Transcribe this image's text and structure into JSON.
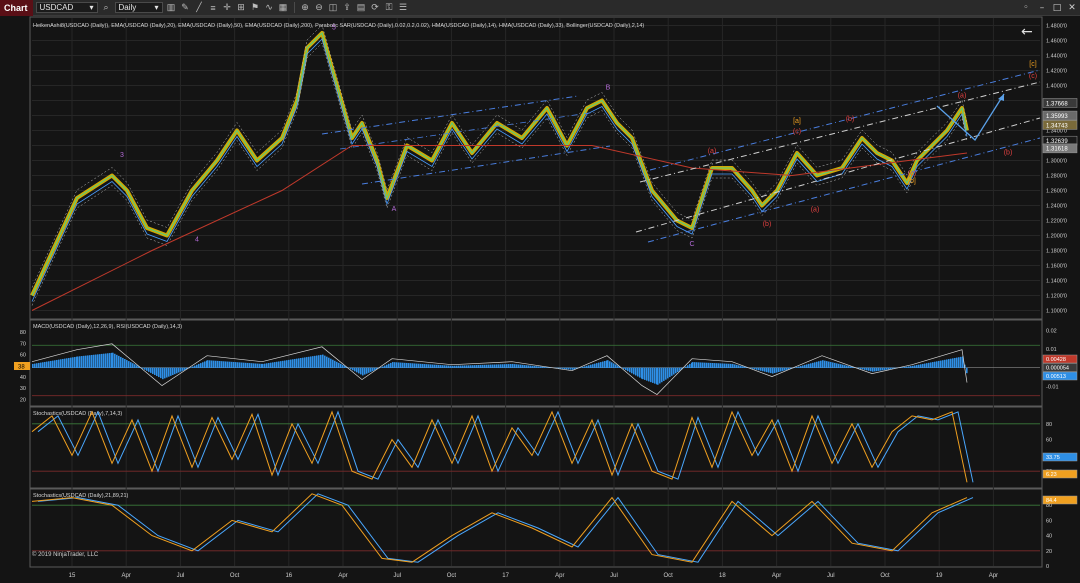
{
  "app": {
    "title": "Chart"
  },
  "toolbar": {
    "instrument": "USDCAD",
    "timeframe": "Daily",
    "icons": [
      "search-icon",
      "bar-chart-icon",
      "drawing-tool-icon",
      "line-tool-icon",
      "text-tool-icon",
      "crosshair-icon",
      "properties-icon",
      "strategy-icon",
      "indicator-icon",
      "template-icon",
      "zoom-in-icon",
      "zoom-out-icon",
      "screenshot-icon",
      "share-icon",
      "calendar-icon",
      "sync-icon",
      "lock-icon",
      "list-icon"
    ],
    "window_controls": [
      "pin-icon",
      "minimize-icon",
      "maximize-icon",
      "close-icon"
    ]
  },
  "copyright": "© 2019 NinjaTrader, LLC",
  "colors": {
    "background": "#141414",
    "heiken_up": "#f2c200",
    "ema_fast": "#4a9eff",
    "ema_slow": "#c0392b",
    "channel": "#4a7fe0",
    "wave_label": "#b36bd6",
    "macd_hist": "#2e8fe6",
    "stoch_k": "#f0a020",
    "stoch_d": "#4aa8ff",
    "grid": "#2e2e2e"
  },
  "chart_data": [
    {
      "type": "line",
      "title": "HeikenAshi8(USDCAD (Daily)), EMA(USDCAD (Daily),20), EMA(USDCAD (Daily),50), EMA(USDCAD (Daily),200), Parabolic SAR(USDCAD (Daily),0.02,0.2,0.02), HMA(USDCAD (Daily),14), HMA(USDCAD (Daily),33), Bollinger(USDCAD (Daily),2,14)",
      "x_ticks": [
        "15",
        "Apr",
        "Jul",
        "Oct",
        "16",
        "Apr",
        "Jul",
        "Oct",
        "17",
        "Apr",
        "Jul",
        "Oct",
        "18",
        "Apr",
        "Jul",
        "Oct",
        "19",
        "Apr"
      ],
      "ylim": [
        1.09,
        1.49
      ],
      "y_ticks": [
        "1.1000'0",
        "1.1200'0",
        "1.1400'0",
        "1.1600'0",
        "1.1800'0",
        "1.2000'0",
        "1.2200'0",
        "1.2400'0",
        "1.2600'0",
        "1.2800'0",
        "1.3000'0",
        "1.3200'0",
        "1.3400'0",
        "1.3600'0",
        "1.3800'0",
        "1.4000'0",
        "1.4200'0",
        "1.4400'0",
        "1.4600'0",
        "1.4800'0"
      ],
      "price_tags": [
        {
          "text": "1.37668",
          "color": "#3a3a3a"
        },
        {
          "text": "1.35993",
          "color": "#6a6a6a"
        },
        {
          "text": "1.34743",
          "color": "#7a6a3a"
        },
        {
          "text": "1.32639",
          "color": "#1a1a1a"
        },
        {
          "text": "1.31618",
          "color": "#7a7a7a"
        }
      ],
      "series": [
        {
          "x": [
            0,
            45,
            80,
            95,
            115,
            135,
            160,
            185,
            205,
            225,
            250,
            265,
            275,
            290,
            305,
            320,
            330,
            345,
            355,
            375,
            400,
            420,
            440,
            465,
            490,
            515,
            535,
            555,
            570,
            585,
            600,
            620,
            645,
            660,
            680,
            700,
            720,
            730,
            745,
            765,
            785,
            810,
            830,
            845,
            860,
            875,
            885,
            900,
            915,
            930,
            935
          ],
          "values": [
            1.12,
            1.25,
            1.28,
            1.26,
            1.21,
            1.2,
            1.26,
            1.3,
            1.34,
            1.3,
            1.33,
            1.38,
            1.45,
            1.47,
            1.4,
            1.33,
            1.35,
            1.3,
            1.25,
            1.32,
            1.3,
            1.35,
            1.31,
            1.35,
            1.33,
            1.37,
            1.32,
            1.37,
            1.38,
            1.35,
            1.33,
            1.26,
            1.22,
            1.21,
            1.29,
            1.29,
            1.26,
            1.24,
            1.26,
            1.31,
            1.28,
            1.29,
            1.33,
            1.31,
            1.3,
            1.27,
            1.3,
            1.32,
            1.34,
            1.37,
            1.34
          ]
        }
      ],
      "annotations": [
        {
          "text": "3",
          "x": 90,
          "y": 1.305,
          "color": "#b36bd6"
        },
        {
          "text": "4",
          "x": 165,
          "y": 1.192,
          "color": "#b36bd6"
        },
        {
          "text": "5",
          "x": 302,
          "y": 1.475,
          "color": "#b36bd6"
        },
        {
          "text": "A",
          "x": 362,
          "y": 1.233,
          "color": "#b36bd6"
        },
        {
          "text": "B",
          "x": 576,
          "y": 1.395,
          "color": "#b36bd6"
        },
        {
          "text": "C",
          "x": 660,
          "y": 1.186,
          "color": "#b36bd6"
        },
        {
          "text": "(a)",
          "x": 680,
          "y": 1.31,
          "color": "#e04040"
        },
        {
          "text": "(b)",
          "x": 735,
          "y": 1.213,
          "color": "#e04040"
        },
        {
          "text": "(a)",
          "x": 783,
          "y": 1.232,
          "color": "#e04040"
        },
        {
          "text": "(b)",
          "x": 818,
          "y": 1.353,
          "color": "#e04040"
        },
        {
          "text": "[a]",
          "x": 765,
          "y": 1.35,
          "color": "#f0a020"
        },
        {
          "text": "(c)",
          "x": 765,
          "y": 1.336,
          "color": "#e04040"
        },
        {
          "text": "[b]",
          "x": 880,
          "y": 1.27,
          "color": "#f0a020"
        },
        {
          "text": "(c)",
          "x": 880,
          "y": 1.28,
          "color": "#e04040"
        },
        {
          "text": "(a)",
          "x": 930,
          "y": 1.384,
          "color": "#e04040"
        },
        {
          "text": "(b)",
          "x": 976,
          "y": 1.308,
          "color": "#e04040"
        },
        {
          "text": "[c]",
          "x": 1001,
          "y": 1.426,
          "color": "#f0a020"
        },
        {
          "text": "(c)",
          "x": 1001,
          "y": 1.41,
          "color": "#e04040"
        }
      ]
    },
    {
      "type": "line",
      "title": "MACD(USDCAD (Daily),12,26,9), RSI(USDCAD (Daily),14,3)",
      "ylim": [
        -0.02,
        0.025
      ],
      "y_ticks_right": [
        "0.02",
        "0.01",
        "0",
        "-0.01"
      ],
      "y_ticks_left": [
        "80",
        "70",
        "60",
        "50",
        "40",
        "30",
        "20"
      ],
      "price_tags": [
        {
          "text": "0.00428",
          "color": "#c0392b"
        },
        {
          "text": "0.000054",
          "color": "#3a3a3a"
        },
        {
          "text": "0.00513",
          "color": "#2e8fe6"
        }
      ],
      "left_tag": "38",
      "series": [
        {
          "name": "MACD histogram",
          "x": [
            0,
            45,
            80,
            130,
            175,
            230,
            290,
            330,
            360,
            420,
            480,
            540,
            575,
            610,
            625,
            660,
            700,
            740,
            790,
            840,
            880,
            930,
            935
          ],
          "values": [
            0.002,
            0.006,
            0.008,
            -0.006,
            0.004,
            0.002,
            0.007,
            -0.004,
            0.003,
            0.001,
            0.002,
            -0.001,
            0.004,
            -0.006,
            -0.009,
            0.003,
            0.002,
            -0.003,
            0.004,
            -0.002,
            0.001,
            0.006,
            -0.005
          ]
        }
      ]
    },
    {
      "type": "line",
      "title": "Stochastics(USDCAD (Daily),7,14,3)",
      "ylim": [
        0,
        100
      ],
      "y_ticks": [
        "80",
        "60",
        "40",
        "20"
      ],
      "price_tags": [
        {
          "text": "33.75",
          "color": "#2e8fe6"
        },
        {
          "text": "6.23",
          "color": "#f0a020"
        }
      ],
      "series": [
        {
          "name": "K",
          "x": [
            0,
            20,
            40,
            60,
            80,
            100,
            120,
            140,
            160,
            180,
            200,
            220,
            240,
            260,
            280,
            300,
            320,
            340,
            360,
            380,
            400,
            420,
            440,
            460,
            480,
            500,
            520,
            540,
            560,
            580,
            600,
            620,
            640,
            660,
            680,
            700,
            720,
            740,
            760,
            780,
            800,
            820,
            840,
            860,
            880,
            900,
            920,
            935
          ],
          "values": [
            70,
            90,
            40,
            95,
            30,
            85,
            20,
            90,
            25,
            88,
            35,
            92,
            15,
            80,
            30,
            95,
            20,
            10,
            60,
            25,
            85,
            30,
            90,
            20,
            75,
            40,
            95,
            30,
            85,
            15,
            80,
            20,
            10,
            88,
            25,
            95,
            40,
            85,
            20,
            90,
            30,
            80,
            25,
            70,
            90,
            85,
            95,
            6
          ]
        }
      ]
    },
    {
      "type": "line",
      "title": "Stochastics(USDCAD (Daily),21,89,21)",
      "ylim": [
        0,
        100
      ],
      "y_ticks": [
        "80",
        "60",
        "40",
        "20",
        "0"
      ],
      "price_tags": [
        {
          "text": "84.4",
          "color": "#f0a020"
        }
      ],
      "series": [
        {
          "name": "K",
          "x": [
            0,
            40,
            80,
            120,
            160,
            200,
            240,
            280,
            310,
            350,
            380,
            420,
            460,
            500,
            540,
            580,
            620,
            660,
            700,
            740,
            780,
            820,
            860,
            900,
            935
          ],
          "values": [
            85,
            90,
            80,
            40,
            20,
            60,
            45,
            95,
            80,
            10,
            5,
            40,
            70,
            50,
            25,
            90,
            15,
            5,
            85,
            40,
            85,
            30,
            20,
            70,
            90
          ]
        }
      ]
    }
  ]
}
